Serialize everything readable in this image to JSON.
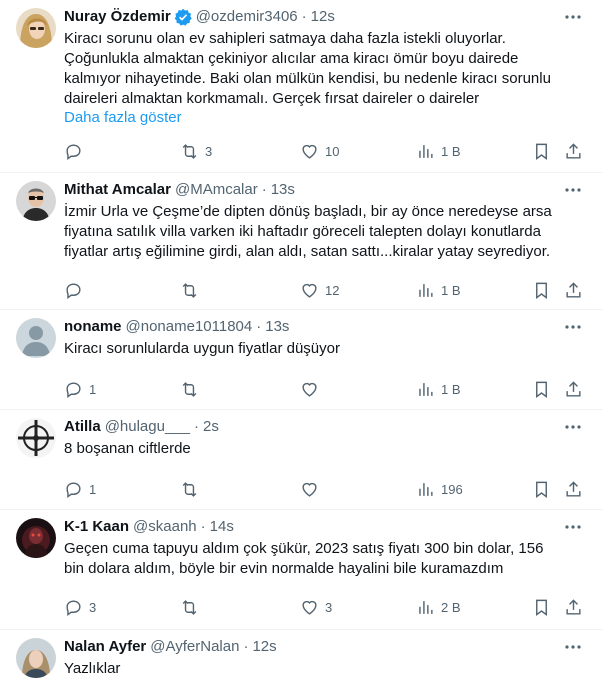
{
  "tweets": [
    {
      "name": "Nuray Özdemir",
      "verified": true,
      "handle": "@ozdemir3406",
      "time": "12s",
      "text": "Kiracı sorunu olan ev sahipleri satmaya daha fazla istekli oluyorlar.\nÇoğunlukla almaktan çekiniyor alıcılar ama kiracı ömür boyu dairede\nkalmıyor nihayetinde. Baki olan mülkün kendisi, bu nedenle kiracı sorunlu\ndaireleri almaktan korkmamalı. Gerçek fırsat daireler o daireler",
      "show_more": "Daha fazla göster",
      "replies": "",
      "retweets": "3",
      "likes": "10",
      "views": "1 B",
      "avatar": "woman-blonde-avatar"
    },
    {
      "name": "Mithat Amcalar",
      "verified": false,
      "handle": "@MAmcalar",
      "time": "13s",
      "text": "İzmir Urla ve Çeşme’de  dipten dönüş başladı, bir ay önce neredeyse arsa\nfiyatına satılık villa varken iki haftadır göreceli talepten dolayı konutlarda\nfiyatlar artış eğilimine girdi, alan aldı, satan sattı...kiralar yatay seyrediyor.",
      "show_more": "",
      "replies": "",
      "retweets": "",
      "likes": "12",
      "views": "1 B",
      "avatar": "man-glasses-avatar"
    },
    {
      "name": "noname",
      "verified": false,
      "handle": "@noname1011804",
      "time": "13s",
      "text": "Kiracı sorunlularda uygun fiyatlar düşüyor",
      "show_more": "",
      "replies": "1",
      "retweets": "",
      "likes": "",
      "views": "1 B",
      "avatar": "default-avatar"
    },
    {
      "name": "Atilla",
      "verified": false,
      "handle": "@hulagu___",
      "time": "2s",
      "text": "8 boşanan ciftlerde",
      "show_more": "",
      "replies": "1",
      "retweets": "",
      "likes": "",
      "views": "196",
      "avatar": "crosshair-avatar"
    },
    {
      "name": "K-1 Kaan",
      "verified": false,
      "handle": "@skaanh",
      "time": "14s",
      "text": "Geçen cuma tapuyu aldım çok şükür, 2023 satış fiyatı 300 bin dolar, 156\nbin dolara aldım, böyle bir evin normalde hayalini bile kuramazdım",
      "show_more": "",
      "replies": "3",
      "retweets": "",
      "likes": "3",
      "views": "2 B",
      "avatar": "dark-fighter-avatar"
    },
    {
      "name": "Nalan Ayfer",
      "verified": false,
      "handle": "@AyferNalan",
      "time": "12s",
      "text": "Yazlıklar",
      "show_more": "",
      "replies": "",
      "retweets": "",
      "likes": "",
      "views": "",
      "avatar": "woman-portrait-avatar"
    }
  ],
  "colors": {
    "text": "#0f1419",
    "secondary": "#536471",
    "link": "#1d9bf0",
    "divider": "#eff3f4",
    "verified": "#1d9bf0"
  }
}
